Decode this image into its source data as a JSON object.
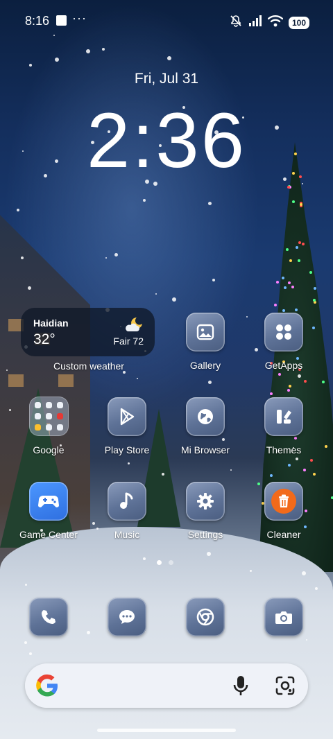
{
  "status_bar": {
    "time": "8:16",
    "overflow": "···",
    "battery": "100"
  },
  "lock": {
    "date": "Fri, Jul 31",
    "time": "2:36"
  },
  "weather_widget": {
    "city": "Haidian",
    "temperature": "32°",
    "condition": "Fair 72",
    "icon": "partly-cloudy-night-icon",
    "label": "Custom weather"
  },
  "apps": [
    {
      "label": "Gallery",
      "icon": "image-icon"
    },
    {
      "label": "GetApps",
      "icon": "grid-icon"
    },
    {
      "label": "Google",
      "icon": "folder-icon"
    },
    {
      "label": "Play Store",
      "icon": "play-icon"
    },
    {
      "label": "Mi Browser",
      "icon": "globe-icon"
    },
    {
      "label": "Themes",
      "icon": "themes-icon"
    },
    {
      "label": "Game Center",
      "icon": "gamepad-icon"
    },
    {
      "label": "Music",
      "icon": "music-note-icon"
    },
    {
      "label": "Settings",
      "icon": "gear-icon"
    },
    {
      "label": "Cleaner",
      "icon": "trash-icon"
    }
  ],
  "dock": [
    "phone-icon",
    "messages-icon",
    "chrome-icon",
    "camera-icon"
  ],
  "search_bar": {
    "icons": [
      "google-logo",
      "mic-icon",
      "lens-icon"
    ]
  },
  "colors": {
    "cleaner_accent": "#f26a1b",
    "game_center_accent": "#2f7ef3"
  }
}
